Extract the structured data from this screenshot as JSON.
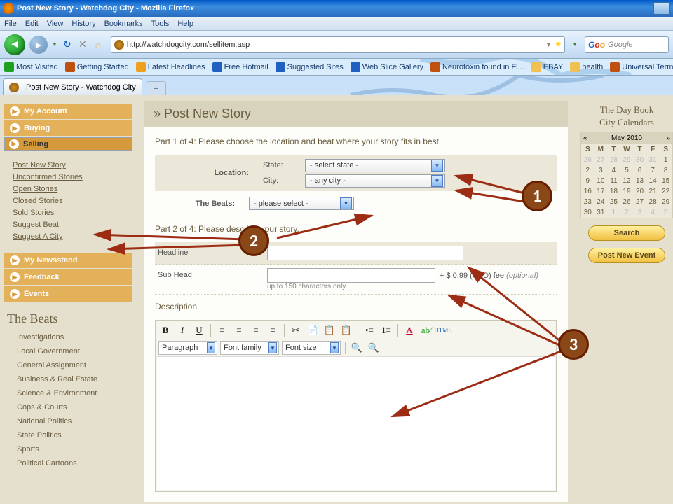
{
  "window": {
    "title": "Post New Story - Watchdog City - Mozilla Firefox"
  },
  "menu": {
    "file": "File",
    "edit": "Edit",
    "view": "View",
    "history": "History",
    "bookmarks": "Bookmarks",
    "tools": "Tools",
    "help": "Help"
  },
  "toolbar": {
    "url": "http://watchdogcity.com/sellitem.asp",
    "search_placeholder": "Google"
  },
  "bookmarks": [
    {
      "label": "Most Visited",
      "color": "#20a020"
    },
    {
      "label": "Getting Started",
      "color": "#c05010"
    },
    {
      "label": "Latest Headlines",
      "color": "#f0a020"
    },
    {
      "label": "Free Hotmail",
      "color": "#2060c0"
    },
    {
      "label": "Suggested Sites",
      "color": "#2060c0"
    },
    {
      "label": "Web Slice Gallery",
      "color": "#2060c0"
    },
    {
      "label": "Neurotoxin found in Fl...",
      "color": "#c05010"
    },
    {
      "label": "EBAY",
      "color": "#f0c050"
    },
    {
      "label": "health",
      "color": "#f0c050"
    },
    {
      "label": "Universal Terms of",
      "color": "#c05010"
    }
  ],
  "tab": {
    "title": "Post New Story - Watchdog City"
  },
  "sidebar": {
    "my_account": "My Account",
    "buying": "Buying",
    "selling": "Selling",
    "links": [
      {
        "label": "Post New Story"
      },
      {
        "label": "Unconfirmed Stories"
      },
      {
        "label": "Open Stories"
      },
      {
        "label": "Closed Stories"
      },
      {
        "label": "Sold Stories"
      },
      {
        "label": "Suggest Beat"
      },
      {
        "label": "Suggest A City"
      }
    ],
    "my_newsstand": "My Newsstand",
    "feedback": "Feedback",
    "events": "Events",
    "beats_heading": "The Beats",
    "beats": [
      "Investigations",
      "Local Government",
      "General Assignment",
      "Business & Real Estate",
      "Science & Environment",
      "Cops & Courts",
      "National Politics",
      "State Politics",
      "Sports",
      "Political Cartoons"
    ]
  },
  "main": {
    "title": "» Post New Story",
    "part1": "Part 1 of 4: Please choose the location and beat where your story fits in best.",
    "location_label": "Location:",
    "state_label": "State:",
    "state_value": "- select state -",
    "city_label": "City:",
    "city_value": "- any city -",
    "beats_label": "The Beats:",
    "beats_value": "- please select -",
    "part2": "Part 2 of 4: Please describe your story.",
    "headline_label": "Headline",
    "subhead_label": "Sub Head",
    "subhead_after": "+ $ 0.99 (USD) fee ",
    "subhead_optional": "(optional)",
    "subhead_hint": "up to 150 characters only.",
    "description_label": "Description",
    "editor": {
      "paragraph": "Paragraph",
      "fontfamily": "Font family",
      "fontsize": "Font size",
      "html": "HTML"
    }
  },
  "right": {
    "title1": "The Day Book",
    "title2": "City Calendars",
    "month": "May 2010",
    "dow": [
      "S",
      "M",
      "T",
      "W",
      "T",
      "F",
      "S"
    ],
    "weeks": [
      [
        {
          "d": "26",
          "off": true
        },
        {
          "d": "27",
          "off": true
        },
        {
          "d": "28",
          "off": true
        },
        {
          "d": "29",
          "off": true
        },
        {
          "d": "30",
          "off": true
        },
        {
          "d": "31",
          "off": true
        },
        {
          "d": "1"
        }
      ],
      [
        {
          "d": "2"
        },
        {
          "d": "3"
        },
        {
          "d": "4"
        },
        {
          "d": "5"
        },
        {
          "d": "6"
        },
        {
          "d": "7"
        },
        {
          "d": "8"
        }
      ],
      [
        {
          "d": "9"
        },
        {
          "d": "10"
        },
        {
          "d": "11"
        },
        {
          "d": "12"
        },
        {
          "d": "13"
        },
        {
          "d": "14"
        },
        {
          "d": "15"
        }
      ],
      [
        {
          "d": "16"
        },
        {
          "d": "17"
        },
        {
          "d": "18"
        },
        {
          "d": "19"
        },
        {
          "d": "20"
        },
        {
          "d": "21"
        },
        {
          "d": "22"
        }
      ],
      [
        {
          "d": "23"
        },
        {
          "d": "24"
        },
        {
          "d": "25"
        },
        {
          "d": "26"
        },
        {
          "d": "27"
        },
        {
          "d": "28"
        },
        {
          "d": "29"
        }
      ],
      [
        {
          "d": "30"
        },
        {
          "d": "31"
        },
        {
          "d": "1",
          "off": true
        },
        {
          "d": "2",
          "off": true
        },
        {
          "d": "3",
          "off": true
        },
        {
          "d": "4",
          "off": true
        },
        {
          "d": "5",
          "off": true
        }
      ]
    ],
    "search": "Search",
    "post": "Post New Event"
  },
  "annotations": {
    "n1": "1",
    "n2": "2",
    "n3": "3"
  }
}
